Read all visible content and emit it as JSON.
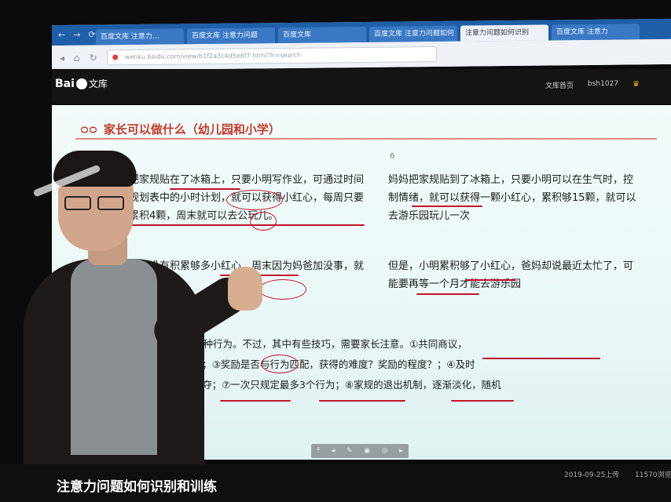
{
  "browser": {
    "nav_icons": [
      "←",
      "→",
      "⟳"
    ],
    "tabs": [
      {
        "label": "百度文库 注意力…"
      },
      {
        "label": "百度文库 注意力问题"
      },
      {
        "label": "百度文库"
      },
      {
        "label": "百度文库 注意力问题如何"
      },
      {
        "label": "注意力问题如何识别"
      },
      {
        "label": "百度文库 注意力"
      }
    ],
    "url": "wenku.baidu.com/view/b1f2a3c4d5e6f7.html?fr=search"
  },
  "site": {
    "logo_text": "Bai",
    "logo_suffix": "文库",
    "links": [
      "文库首页",
      "bsh1027"
    ]
  },
  "slide": {
    "title": "家长可以做什么（幼儿园和小学）",
    "page_number": "6",
    "left_para1": "把家规贴在了冰箱上，只要小明写作业，可通过时间规划表中的小时计划，就可以获得小红心，每周只要累积4颗，周末就可以去公玩儿。",
    "left_para2": "但周没有积累够多小红心，周末因为妈爸加没事，就要去公园了",
    "right_para1": "妈妈把家规贴到了冰箱上，只要小明可以在生气时，控制情绪，就可以获得一颗小红心，累积够15颗，就可以去游乐园玩儿一次",
    "right_para2": "但是，小明累积够了小红心，爸妈却说最近太忙了，可能要再等一个月才能去游乐园",
    "section2_head": "行为",
    "bottom_line1": "正孩子的某种行为。不过，其中有些技巧，需要家长注意。①共同商议，",
    "bottom_line2": "么？②公示；③奖励是否与行为匹配，获得的难度？奖励的程度？；④及时",
    "bottom_line3": "；⑥不能剥夺；⑦一次只规定最多3个行为；⑧家规的退出机制，逐渐淡化，随机",
    "toolbar_icons": [
      "⤒",
      "◂",
      "✎",
      "◉",
      "◎",
      "▸"
    ]
  },
  "footer": {
    "doc_title": "注意力问题如何识别和训练",
    "date": "2019-09-25上传",
    "views": "11570浏览"
  }
}
